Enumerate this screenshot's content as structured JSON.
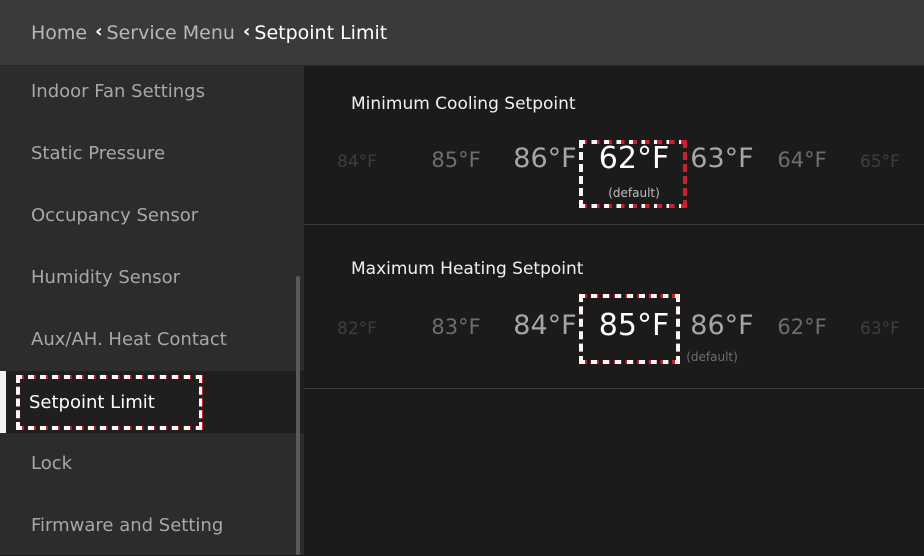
{
  "header": {
    "crumb_home": "Home",
    "crumb_service": "Service Menu",
    "crumb_current": "Setpoint Limit"
  },
  "sidebar": {
    "items": [
      {
        "label": "Indoor Fan Settings"
      },
      {
        "label": "Static Pressure"
      },
      {
        "label": "Occupancy Sensor"
      },
      {
        "label": "Humidity Sensor"
      },
      {
        "label": "Aux/AH. Heat Contact"
      },
      {
        "label": "Setpoint Limit"
      },
      {
        "label": "Lock"
      },
      {
        "label": "Firmware and Setting"
      }
    ],
    "selected_index": 5
  },
  "cooling": {
    "title": "Minimum Cooling Setpoint",
    "values": [
      "84°F",
      "85°F",
      "86°F",
      "62°F",
      "63°F",
      "64°F",
      "65°F"
    ],
    "selected": "62°F",
    "default_label": "(default)"
  },
  "heating": {
    "title": "Maximum Heating Setpoint",
    "values": [
      "82°F",
      "83°F",
      "84°F",
      "85°F",
      "86°F",
      "62°F",
      "63°F"
    ],
    "selected": "85°F",
    "default_label": "(default)"
  },
  "colors": {
    "highlight": "#c8202c",
    "header_bg": "#3a3a3a",
    "sidebar_bg": "#2c2c2c",
    "main_bg": "#1b1b1b"
  }
}
